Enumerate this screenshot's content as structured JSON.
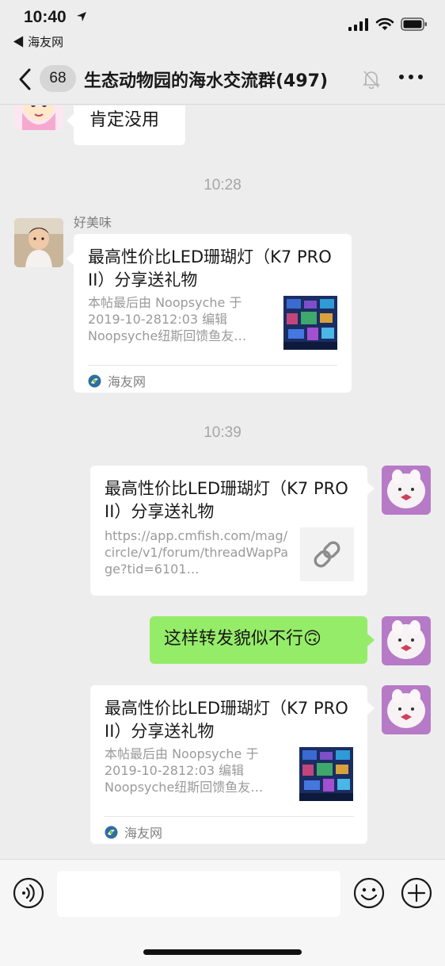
{
  "status_bar": {
    "time": "10:40",
    "back_app": "◀ 海友网"
  },
  "nav": {
    "unread_count": "68",
    "title": "生态动物园的海水交流群(497)"
  },
  "messages": {
    "m1": {
      "text": "肯定没用"
    },
    "ts1": "10:28",
    "m2": {
      "sender": "好美味",
      "title": "最高性价比LED珊瑚灯（K7 PRO II）分享送礼物",
      "desc": "本帖最后由 Noopsyche 于 2019-10-2812:03 编辑 Noopsyche纽斯回馈鱼友…",
      "source": "海友网"
    },
    "ts2": "10:39",
    "m3": {
      "title": "最高性价比LED珊瑚灯（K7 PRO II）分享送礼物",
      "desc": "https://app.cmfish.com/mag/circle/v1/forum/threadWapPage?tid=6101…"
    },
    "m4": {
      "text": "这样转发貌似不行🙃"
    },
    "m5": {
      "title": "最高性价比LED珊瑚灯（K7 PRO II）分享送礼物",
      "desc": "本帖最后由 Noopsyche 于 2019-10-2812:03 编辑 Noopsyche纽斯回馈鱼友…",
      "source": "海友网"
    }
  },
  "input": {
    "placeholder": ""
  },
  "colors": {
    "background": "#ededed",
    "bubble_green": "#95ec69",
    "bubble_white": "#ffffff",
    "timestamp": "#a6a6a6"
  },
  "icons": [
    "location-arrow-icon",
    "signal-icon",
    "wifi-icon",
    "battery-icon",
    "back-chevron-icon",
    "mute-bell-icon",
    "more-icon",
    "link-icon",
    "site-logo-icon",
    "voice-icon",
    "emoji-icon",
    "plus-icon"
  ]
}
